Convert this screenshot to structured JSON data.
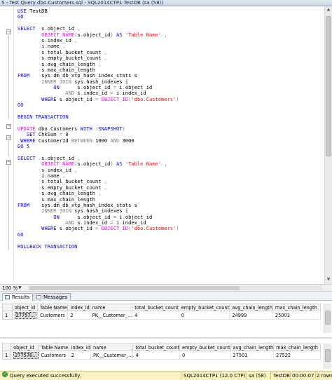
{
  "window": {
    "title": "5 - Test Query dbo.Customers.sql - SQL2014CTP1.TestDB (sa (58))"
  },
  "editor": {
    "lines": [
      [
        {
          "t": "USE ",
          "c": "kw"
        },
        {
          "t": "TestDB",
          "c": "tx"
        }
      ],
      [
        {
          "t": "GO",
          "c": "kw"
        }
      ],
      [],
      [
        {
          "t": "SELECT  ",
          "c": "kw"
        },
        {
          "t": "s",
          "c": "tx"
        },
        {
          "t": ".",
          "c": "gr"
        },
        {
          "t": "object_id ",
          "c": "tx"
        },
        {
          "t": ",",
          "c": "gr"
        }
      ],
      [
        {
          "t": "        ",
          "c": "tx"
        },
        {
          "t": "OBJECT_NAME",
          "c": "fn"
        },
        {
          "t": "(",
          "c": "gr"
        },
        {
          "t": "s",
          "c": "tx"
        },
        {
          "t": ".",
          "c": "gr"
        },
        {
          "t": "object_id",
          "c": "tx"
        },
        {
          "t": ")",
          "c": "gr"
        },
        {
          "t": " AS ",
          "c": "kw"
        },
        {
          "t": "'Table Name'",
          "c": "str"
        },
        {
          "t": " ,",
          "c": "gr"
        }
      ],
      [
        {
          "t": "        s",
          "c": "tx"
        },
        {
          "t": ".",
          "c": "gr"
        },
        {
          "t": "index_id ",
          "c": "tx"
        },
        {
          "t": ",",
          "c": "gr"
        }
      ],
      [
        {
          "t": "        i",
          "c": "tx"
        },
        {
          "t": ".",
          "c": "gr"
        },
        {
          "t": "name ",
          "c": "tx"
        },
        {
          "t": ",",
          "c": "gr"
        }
      ],
      [
        {
          "t": "        s",
          "c": "tx"
        },
        {
          "t": ".",
          "c": "gr"
        },
        {
          "t": "total_bucket_count ",
          "c": "tx"
        },
        {
          "t": ",",
          "c": "gr"
        }
      ],
      [
        {
          "t": "        s",
          "c": "tx"
        },
        {
          "t": ".",
          "c": "gr"
        },
        {
          "t": "empty_bucket_count ",
          "c": "tx"
        },
        {
          "t": ",",
          "c": "gr"
        }
      ],
      [
        {
          "t": "        s",
          "c": "tx"
        },
        {
          "t": ".",
          "c": "gr"
        },
        {
          "t": "avg_chain_length ",
          "c": "tx"
        },
        {
          "t": ",",
          "c": "gr"
        }
      ],
      [
        {
          "t": "        s",
          "c": "tx"
        },
        {
          "t": ".",
          "c": "gr"
        },
        {
          "t": "max_chain_length",
          "c": "tx"
        }
      ],
      [
        {
          "t": "FROM    ",
          "c": "kw"
        },
        {
          "t": "sys",
          "c": "tx"
        },
        {
          "t": ".",
          "c": "gr"
        },
        {
          "t": "dm_db_xtp_hash_index_stats s",
          "c": "tx"
        }
      ],
      [
        {
          "t": "        ",
          "c": "tx"
        },
        {
          "t": "INNER JOIN",
          "c": "gr"
        },
        {
          "t": " sys",
          "c": "tx"
        },
        {
          "t": ".",
          "c": "gr"
        },
        {
          "t": "hash_indexes i",
          "c": "tx"
        }
      ],
      [
        {
          "t": "            ",
          "c": "tx"
        },
        {
          "t": "ON",
          "c": "kw"
        },
        {
          "t": "      s",
          "c": "tx"
        },
        {
          "t": ".",
          "c": "gr"
        },
        {
          "t": "object_id ",
          "c": "tx"
        },
        {
          "t": "=",
          "c": "gr"
        },
        {
          "t": " i",
          "c": "tx"
        },
        {
          "t": ".",
          "c": "gr"
        },
        {
          "t": "object_id",
          "c": "tx"
        }
      ],
      [
        {
          "t": "                ",
          "c": "tx"
        },
        {
          "t": "AND",
          "c": "gr"
        },
        {
          "t": " s",
          "c": "tx"
        },
        {
          "t": ".",
          "c": "gr"
        },
        {
          "t": "index_id ",
          "c": "tx"
        },
        {
          "t": "=",
          "c": "gr"
        },
        {
          "t": " i",
          "c": "tx"
        },
        {
          "t": ".",
          "c": "gr"
        },
        {
          "t": "index_id",
          "c": "tx"
        }
      ],
      [
        {
          "t": "        ",
          "c": "tx"
        },
        {
          "t": "WHERE",
          "c": "kw"
        },
        {
          "t": " s",
          "c": "tx"
        },
        {
          "t": ".",
          "c": "gr"
        },
        {
          "t": "object_id ",
          "c": "tx"
        },
        {
          "t": "=",
          "c": "gr"
        },
        {
          "t": " ",
          "c": "tx"
        },
        {
          "t": "OBJECT_ID",
          "c": "fn"
        },
        {
          "t": "(",
          "c": "gr"
        },
        {
          "t": "'dbo.Customers'",
          "c": "str"
        },
        {
          "t": ")",
          "c": "gr"
        }
      ],
      [
        {
          "t": "GO",
          "c": "kw"
        }
      ],
      [],
      [
        {
          "t": "BEGIN TRANSACTION",
          "c": "kw"
        }
      ],
      [],
      [
        {
          "t": "UPDATE",
          "c": "fn"
        },
        {
          "t": " dbo",
          "c": "tx"
        },
        {
          "t": ".",
          "c": "gr"
        },
        {
          "t": "Customers ",
          "c": "tx"
        },
        {
          "t": "WITH",
          "c": "kw"
        },
        {
          "t": " (",
          "c": "gr"
        },
        {
          "t": "SNAPSHOT",
          "c": "kw"
        },
        {
          "t": ")",
          "c": "gr"
        }
      ],
      [
        {
          "t": "   ",
          "c": "tx"
        },
        {
          "t": "SET",
          "c": "kw"
        },
        {
          "t": " ChkSum ",
          "c": "tx"
        },
        {
          "t": "=",
          "c": "gr"
        },
        {
          "t": " 0",
          "c": "tx"
        }
      ],
      [
        {
          "t": " ",
          "c": "tx"
        },
        {
          "t": "WHERE",
          "c": "kw"
        },
        {
          "t": " CustomerId ",
          "c": "tx"
        },
        {
          "t": "BETWEEN",
          "c": "gr"
        },
        {
          "t": " 1000 ",
          "c": "tx"
        },
        {
          "t": "AND",
          "c": "gr"
        },
        {
          "t": " 3000",
          "c": "tx"
        }
      ],
      [
        {
          "t": "GO",
          "c": "kw"
        },
        {
          "t": " 5",
          "c": "tx"
        }
      ],
      [],
      [
        {
          "t": "SELECT  ",
          "c": "kw"
        },
        {
          "t": "s",
          "c": "tx"
        },
        {
          "t": ".",
          "c": "gr"
        },
        {
          "t": "object_id ",
          "c": "tx"
        },
        {
          "t": ",",
          "c": "gr"
        }
      ],
      [
        {
          "t": "        ",
          "c": "tx"
        },
        {
          "t": "OBJECT_NAME",
          "c": "fn"
        },
        {
          "t": "(",
          "c": "gr"
        },
        {
          "t": "s",
          "c": "tx"
        },
        {
          "t": ".",
          "c": "gr"
        },
        {
          "t": "object_id",
          "c": "tx"
        },
        {
          "t": ")",
          "c": "gr"
        },
        {
          "t": " AS ",
          "c": "kw"
        },
        {
          "t": "'Table Name'",
          "c": "str"
        },
        {
          "t": " ,",
          "c": "gr"
        }
      ],
      [
        {
          "t": "        s",
          "c": "tx"
        },
        {
          "t": ".",
          "c": "gr"
        },
        {
          "t": "index_id ",
          "c": "tx"
        },
        {
          "t": ",",
          "c": "gr"
        }
      ],
      [
        {
          "t": "        i",
          "c": "tx"
        },
        {
          "t": ".",
          "c": "gr"
        },
        {
          "t": "name ",
          "c": "tx"
        },
        {
          "t": ",",
          "c": "gr"
        }
      ],
      [
        {
          "t": "        s",
          "c": "tx"
        },
        {
          "t": ".",
          "c": "gr"
        },
        {
          "t": "total_bucket_count ",
          "c": "tx"
        },
        {
          "t": ",",
          "c": "gr"
        }
      ],
      [
        {
          "t": "        s",
          "c": "tx"
        },
        {
          "t": ".",
          "c": "gr"
        },
        {
          "t": "empty_bucket_count ",
          "c": "tx"
        },
        {
          "t": ",",
          "c": "gr"
        }
      ],
      [
        {
          "t": "        s",
          "c": "tx"
        },
        {
          "t": ".",
          "c": "gr"
        },
        {
          "t": "avg_chain_length ",
          "c": "tx"
        },
        {
          "t": ",",
          "c": "gr"
        }
      ],
      [
        {
          "t": "        s",
          "c": "tx"
        },
        {
          "t": ".",
          "c": "gr"
        },
        {
          "t": "max_chain_length",
          "c": "tx"
        }
      ],
      [
        {
          "t": "FROM    ",
          "c": "kw"
        },
        {
          "t": "sys",
          "c": "tx"
        },
        {
          "t": ".",
          "c": "gr"
        },
        {
          "t": "dm_db_xtp_hash_index_stats s",
          "c": "tx"
        }
      ],
      [
        {
          "t": "        ",
          "c": "tx"
        },
        {
          "t": "INNER JOIN",
          "c": "gr"
        },
        {
          "t": " sys",
          "c": "tx"
        },
        {
          "t": ".",
          "c": "gr"
        },
        {
          "t": "hash_indexes i",
          "c": "tx"
        }
      ],
      [
        {
          "t": "            ",
          "c": "tx"
        },
        {
          "t": "ON",
          "c": "kw"
        },
        {
          "t": "      s",
          "c": "tx"
        },
        {
          "t": ".",
          "c": "gr"
        },
        {
          "t": "object_id ",
          "c": "tx"
        },
        {
          "t": "=",
          "c": "gr"
        },
        {
          "t": " i",
          "c": "tx"
        },
        {
          "t": ".",
          "c": "gr"
        },
        {
          "t": "object_id",
          "c": "tx"
        }
      ],
      [
        {
          "t": "                ",
          "c": "tx"
        },
        {
          "t": "AND",
          "c": "gr"
        },
        {
          "t": " s",
          "c": "tx"
        },
        {
          "t": ".",
          "c": "gr"
        },
        {
          "t": "index_id ",
          "c": "tx"
        },
        {
          "t": "=",
          "c": "gr"
        },
        {
          "t": " i",
          "c": "tx"
        },
        {
          "t": ".",
          "c": "gr"
        },
        {
          "t": "index_id",
          "c": "tx"
        }
      ],
      [
        {
          "t": "        ",
          "c": "tx"
        },
        {
          "t": "WHERE",
          "c": "kw"
        },
        {
          "t": " s",
          "c": "tx"
        },
        {
          "t": ".",
          "c": "gr"
        },
        {
          "t": "object_id ",
          "c": "tx"
        },
        {
          "t": "=",
          "c": "gr"
        },
        {
          "t": " ",
          "c": "tx"
        },
        {
          "t": "OBJECT_ID",
          "c": "fn"
        },
        {
          "t": "(",
          "c": "gr"
        },
        {
          "t": "'dbo.Customers'",
          "c": "str"
        },
        {
          "t": ")",
          "c": "gr"
        }
      ],
      [
        {
          "t": "GO",
          "c": "kw"
        }
      ],
      [],
      [
        {
          "t": "ROLLBACK TRANSACTION",
          "c": "kw"
        }
      ]
    ]
  },
  "zoom": {
    "level": "100 %"
  },
  "tabs": {
    "results": "Results",
    "messages": "Messages"
  },
  "grid": {
    "columns": [
      "object_id",
      "Table Name",
      "index_id",
      "name",
      "total_bucket_count",
      "empty_bucket_count",
      "avg_chain_length",
      "max_chain_length"
    ],
    "grid1": {
      "rownum": "1",
      "cells": [
        "27757...",
        "Customers",
        "2",
        "PK__Customer_...",
        "4",
        "0",
        "24999",
        "25003"
      ]
    },
    "grid2": {
      "rownum": "1",
      "cells": [
        "277576...",
        "Customers",
        "2",
        "PK__Customer_...",
        "4",
        "0",
        "27501",
        "27522"
      ]
    }
  },
  "status": {
    "message": "Query executed successfully.",
    "server": "SQL2014CTP1 (12.0 CTP)",
    "user": "sa (58)",
    "database": "TestDB",
    "elapsed": "00:00:07",
    "rows": "2 rows"
  },
  "colors": {
    "keyword": "#0000ff",
    "function": "#ff00ff",
    "string": "#ff0000",
    "operator": "#808080",
    "status_bg": "#fbf3bf"
  }
}
